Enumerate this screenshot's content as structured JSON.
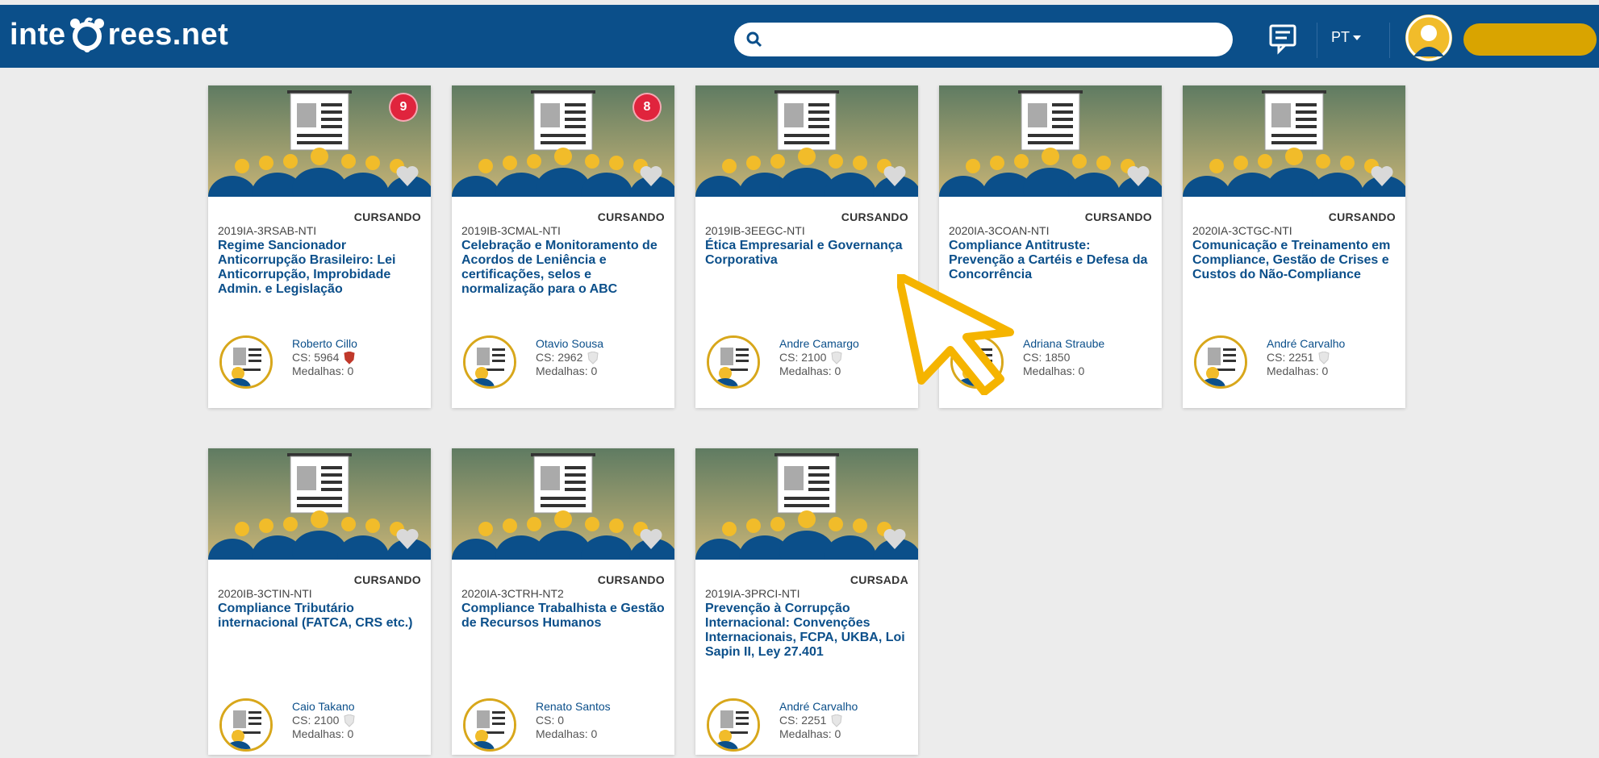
{
  "header": {
    "logo_left": "inte",
    "logo_right": "rees.net",
    "search_placeholder": "",
    "language": "PT",
    "brand_color": "#0b4f8a",
    "accent_color": "#d9a400"
  },
  "courses": [
    {
      "status": "CURSANDO",
      "code": "2019IA-3RSAB-NTI",
      "title": "Regime Sancionador Anticorrupção Brasileiro: Lei Anticorrupção, Improbidade Admin. e Legislação",
      "badge": "9",
      "teacher": "Roberto Cillo",
      "cs": "CS: 5964",
      "medals": "Medalhas: 0",
      "shield": "red"
    },
    {
      "status": "CURSANDO",
      "code": "2019IB-3CMAL-NTI",
      "title": "Celebração e Monitoramento de Acordos de Leniência e certificações, selos e normalização para o ABC",
      "badge": "8",
      "teacher": "Otavio Sousa",
      "cs": "CS: 2962",
      "medals": "Medalhas: 0",
      "shield": "grey"
    },
    {
      "status": "CURSANDO",
      "code": "2019IB-3EEGC-NTI",
      "title": "Ética Empresarial e Governança Corporativa",
      "badge": "",
      "teacher": "Andre Camargo",
      "cs": "CS: 2100",
      "medals": "Medalhas: 0",
      "shield": "grey"
    },
    {
      "status": "CURSANDO",
      "code": "2020IA-3COAN-NTI",
      "title": "Compliance Antitruste: Prevenção a Cartéis e Defesa da Concorrência",
      "badge": "",
      "teacher": "Adriana Straube",
      "cs": "CS: 1850",
      "medals": "Medalhas: 0",
      "shield": "none"
    },
    {
      "status": "CURSANDO",
      "code": "2020IA-3CTGC-NTI",
      "title": "Comunicação e Treinamento em Compliance, Gestão de Crises e Custos do Não-Compliance",
      "badge": "",
      "teacher": "André Carvalho",
      "cs": "CS: 2251",
      "medals": "Medalhas: 0",
      "shield": "grey"
    },
    {
      "status": "CURSANDO",
      "code": "2020IB-3CTIN-NTI",
      "title": "Compliance Tributário internacional (FATCA, CRS etc.)",
      "badge": "",
      "teacher": "Caio Takano",
      "cs": "CS: 2100",
      "medals": "Medalhas: 0",
      "shield": "grey"
    },
    {
      "status": "CURSANDO",
      "code": "2020IA-3CTRH-NT2",
      "title": "Compliance Trabalhista e Gestão de Recursos Humanos",
      "badge": "",
      "teacher": "Renato Santos",
      "cs": "CS: 0",
      "medals": "Medalhas: 0",
      "shield": "none"
    },
    {
      "status": "CURSADA",
      "code": "2019IA-3PRCI-NTI",
      "title": "Prevenção à Corrupção Internacional: Convenções Internacionais, FCPA, UKBA, Loi Sapin II, Ley 27.401",
      "badge": "",
      "teacher": "André Carvalho",
      "cs": "CS: 2251",
      "medals": "Medalhas: 0",
      "shield": "grey"
    }
  ]
}
